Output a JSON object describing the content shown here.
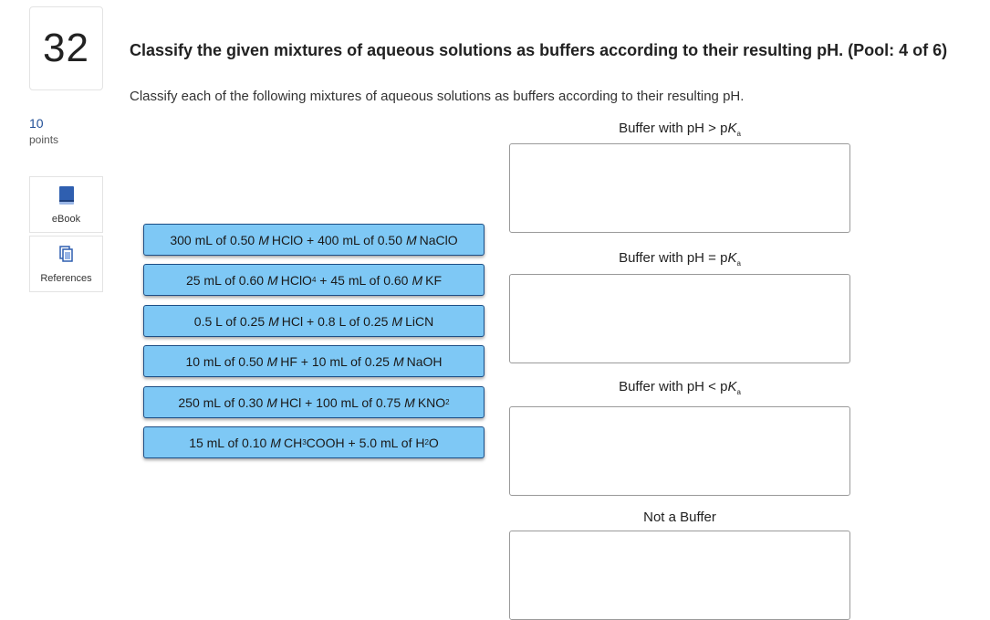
{
  "question": {
    "number": "32",
    "points_value": "10",
    "points_label": "points",
    "title": "Classify the given mixtures of aqueous solutions as buffers according to their resulting pH. (Pool: 4 of 6)",
    "instruction": "Classify each of the following mixtures of aqueous solutions as buffers according to their resulting pH."
  },
  "resources": [
    {
      "label": "eBook",
      "icon": "book-icon"
    },
    {
      "label": "References",
      "icon": "references-icon"
    }
  ],
  "items": [
    {
      "vol1": "300 mL of 0.50",
      "m1": "M",
      "s1": "HClO",
      "plus": " + ",
      "vol2": "400 mL of 0.50",
      "m2": "M",
      "s2": "NaClO"
    },
    {
      "vol1": "25 mL of 0.60",
      "m1": "M",
      "s1a": "HClO",
      "s1sub": "4",
      "plus": " + ",
      "vol2": "45 mL of 0.60",
      "m2": "M",
      "s2": "KF"
    },
    {
      "vol1": "0.5 L of 0.25",
      "m1": "M",
      "s1": "HCl",
      "plus": " + ",
      "vol2": "0.8 L of 0.25",
      "m2": "M",
      "s2": "LiCN"
    },
    {
      "vol1": "10 mL of 0.50",
      "m1": "M",
      "s1": "HF",
      "plus": " + ",
      "vol2": "10 mL of 0.25",
      "m2": "M",
      "s2": "NaOH"
    },
    {
      "vol1": "250 mL of 0.30",
      "m1": "M",
      "s1": "HCl",
      "plus": " + ",
      "vol2": "100 mL of 0.75",
      "m2": "M",
      "s2a": "KNO",
      "s2sub": "2"
    },
    {
      "vol1": "15 mL of 0.10",
      "m1": "M",
      "s1a": "CH",
      "s1sub": "3",
      "s1b": "COOH",
      "plus": " + ",
      "vol2": "5.0 mL of H",
      "v2sub": "2",
      "v2b": "O"
    }
  ],
  "zones": [
    {
      "prefix": "Buffer with pH > p",
      "k": "K",
      "ksub": "a"
    },
    {
      "prefix": "Buffer with pH = p",
      "k": "K",
      "ksub": "a"
    },
    {
      "prefix": "Buffer with pH < p",
      "k": "K",
      "ksub": "a"
    },
    {
      "label": "Not a Buffer"
    }
  ]
}
